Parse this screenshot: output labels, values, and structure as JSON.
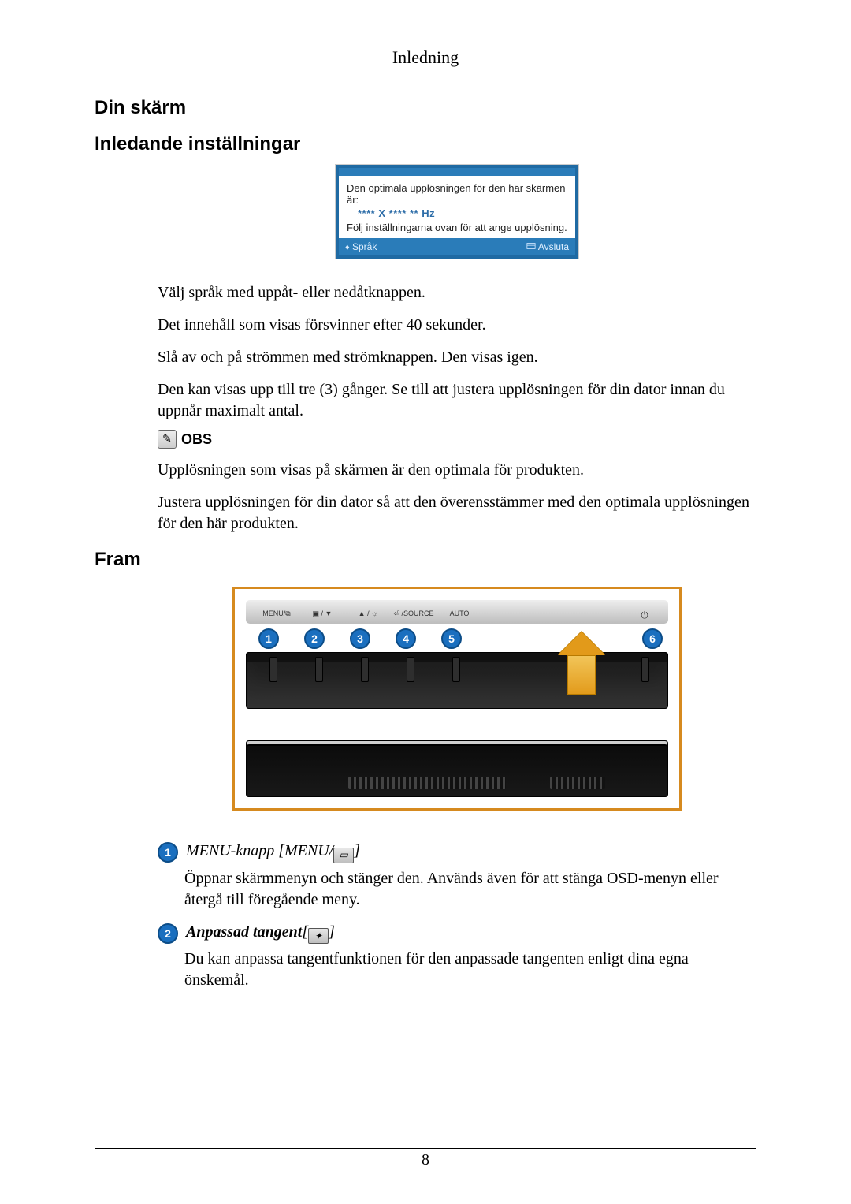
{
  "header": {
    "title": "Inledning"
  },
  "h_din_skarm": "Din skärm",
  "h_inledande": "Inledande inställningar",
  "osd": {
    "line1": "Den optimala upplösningen för den här skärmen är:",
    "hz": "**** X ****  ** Hz",
    "line2": "Följ inställningarna ovan för att ange upplösning.",
    "sprak": "Språk",
    "avsluta": "Avsluta"
  },
  "p1": "Välj språk med uppåt- eller nedåtknappen.",
  "p2": "Det innehåll som visas försvinner efter 40 sekunder.",
  "p3": "Slå av och på strömmen med strömknappen. Den visas igen.",
  "p4": "Den kan visas upp till tre (3) gånger. Se till att justera upplösningen för din dator innan du uppnår maximalt antal.",
  "obs_label": "OBS",
  "p5": "Upplösningen som visas på skärmen är den optimala för produkten.",
  "p6": "Justera upplösningen för din dator så att den överensstämmer med den optimala upplösningen för den här produkten.",
  "h_fram": "Fram",
  "diagram": {
    "labels": [
      "MENU/⧉",
      "▣ / ▼",
      "▲ / ☼",
      "⏎ /SOURCE",
      "AUTO"
    ],
    "power": "⏻",
    "numbers": [
      "1",
      "2",
      "3",
      "4",
      "5",
      "6"
    ]
  },
  "defs": {
    "d1": {
      "num": "1",
      "title_a": "MENU-knapp [MENU/",
      "title_b": "]",
      "body": "Öppnar skärmmenyn och stänger den. Används även för att stänga OSD-menyn eller återgå till föregående meny."
    },
    "d2": {
      "num": "2",
      "title_a": "Anpassad tangent",
      "title_b_open": "[",
      "title_b_close": "]",
      "body": "Du kan anpassa tangentfunktionen för den anpassade tangenten enligt dina egna önskemål."
    }
  },
  "page_number": "8"
}
